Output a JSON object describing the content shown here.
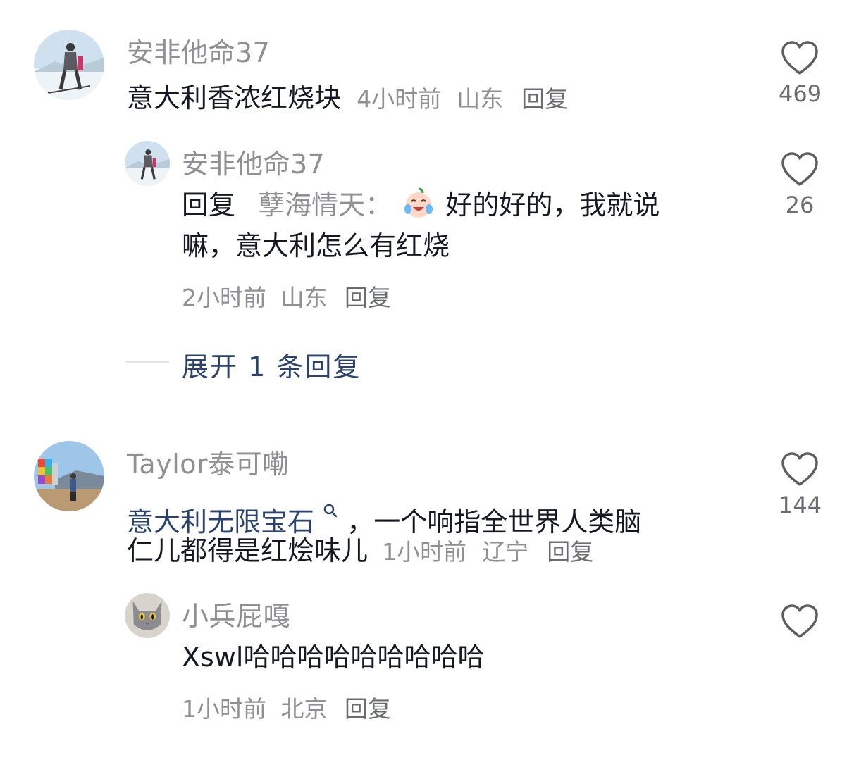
{
  "comments": [
    {
      "user": "安非他命37",
      "text": "意大利香浓红烧块",
      "time": "4小时前",
      "location": "山东",
      "reply_label": "回复",
      "likes": "469",
      "replies": [
        {
          "user": "安非他命37",
          "reply_prefix": "回复",
          "reply_to": "孽海情天：",
          "emoji": "crying-laughing-emoji",
          "text_line1": "好的好的，我就说",
          "text_line2": "嘛，意大利怎么有红烧",
          "time": "2小时前",
          "location": "山东",
          "reply_label": "回复",
          "likes": "26"
        }
      ],
      "expand_label": "展开 1 条回复"
    },
    {
      "user": "Taylor泰可嘞",
      "link_text": "意大利无限宝石",
      "text_line1_rest": "，一个响指全世界人类脑",
      "text_line2": "仁儿都得是红烩味儿",
      "time": "1小时前",
      "location": "辽宁",
      "reply_label": "回复",
      "likes": "144",
      "replies": [
        {
          "user": "小兵屁嘎",
          "text": "Xswl哈哈哈哈哈哈哈哈哈",
          "time": "1小时前",
          "location": "北京",
          "reply_label": "回复"
        }
      ]
    }
  ],
  "icons": {
    "like": "heart-outline-icon",
    "search_link": "search-icon"
  },
  "colors": {
    "text": "#161823",
    "meta": "#8f8f94",
    "link": "#2b4370"
  }
}
